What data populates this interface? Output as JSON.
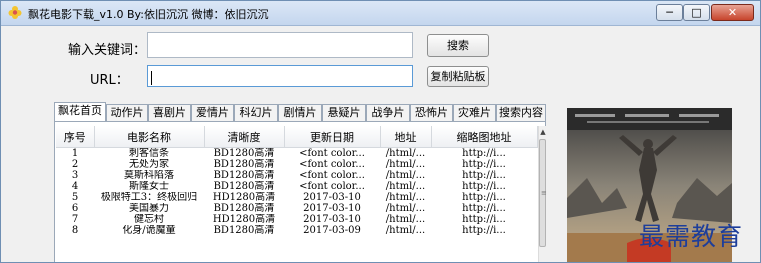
{
  "window": {
    "title": "飘花电影下载_v1.0  By:依旧沉沉  微博：依旧沉沉",
    "controls": {
      "minimize": "─",
      "maximize": "□",
      "close": "✕"
    }
  },
  "search": {
    "keyword_label": "输入关键词：",
    "keyword_value": "",
    "search_button": "搜索",
    "url_label": "URL：",
    "url_value": "",
    "copy_button": "复制粘贴板"
  },
  "tabs": [
    "飘花首页",
    "动作片",
    "喜剧片",
    "爱情片",
    "科幻片",
    "剧情片",
    "悬疑片",
    "战争片",
    "恐怖片",
    "灾难片",
    "搜索内容"
  ],
  "active_tab": "飘花首页",
  "table": {
    "columns": [
      "序号",
      "电影名称",
      "清晰度",
      "更新日期",
      "地址",
      "缩略图地址"
    ],
    "rows": [
      [
        "1",
        "刺客信条",
        "BD1280高清",
        "<font color...",
        "/html/...",
        "http://i..."
      ],
      [
        "2",
        "无处为家",
        "BD1280高清",
        "<font color...",
        "/html/...",
        "http://i..."
      ],
      [
        "3",
        "莫斯科陷落",
        "BD1280高清",
        "<font color...",
        "/html/...",
        "http://i..."
      ],
      [
        "4",
        "斯隆女士",
        "BD1280高清",
        "<font color...",
        "/html/...",
        "http://i..."
      ],
      [
        "5",
        "极限特工3：终极回归",
        "HD1280高清",
        "2017-03-10",
        "/html/...",
        "http://i..."
      ],
      [
        "6",
        "美国暴力",
        "BD1280高清",
        "2017-03-10",
        "/html/...",
        "http://i..."
      ],
      [
        "7",
        "健忘村",
        "HD1280高清",
        "2017-03-10",
        "/html/...",
        "http://i..."
      ],
      [
        "8",
        "化身/诡魔童",
        "BD1280高清",
        "2017-03-09",
        "/html/...",
        "http://i..."
      ]
    ]
  },
  "watermark": "最需教育",
  "colors": {
    "titlebar": "#c4d6ee",
    "accent": "#5a9ad6",
    "watermark": "#1e3e9a",
    "close": "#c7442c"
  },
  "icons": {
    "app": "flower-icon",
    "scroll_up": "chevron-up-icon"
  }
}
